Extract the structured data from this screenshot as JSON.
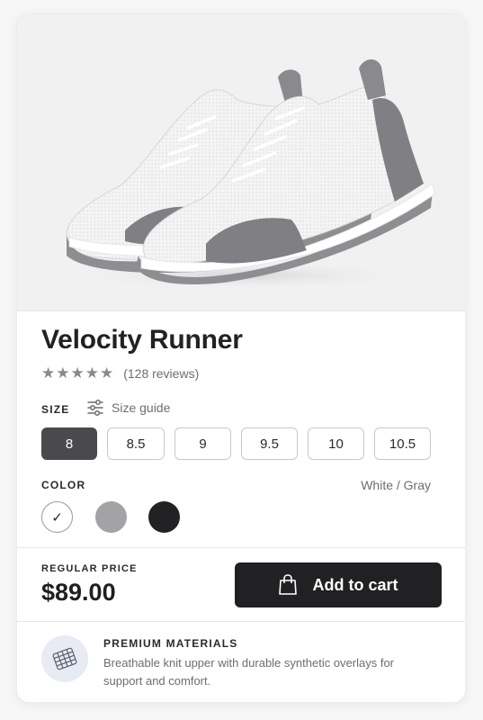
{
  "product": {
    "title": "Velocity Runner",
    "image_alt": "white and gray running shoes",
    "rating_stars": "★★★★★",
    "rating_value": 5,
    "reviews": "(128 reviews)"
  },
  "size": {
    "label": "SIZE",
    "guide_label": "Size guide",
    "options": [
      "8",
      "8.5",
      "9",
      "9.5",
      "10",
      "10.5"
    ],
    "selected": "8"
  },
  "color": {
    "label": "COLOR",
    "selected_name": "White / Gray",
    "swatches": [
      {
        "name": "white",
        "hex": "#ffffff",
        "selected": true
      },
      {
        "name": "gray",
        "hex": "#a3a3a6",
        "selected": false
      },
      {
        "name": "black",
        "hex": "#222224",
        "selected": false
      }
    ],
    "check_glyph": "✓"
  },
  "pricing": {
    "label": "REGULAR PRICE",
    "price": "$89.00",
    "cta_label": "Add to cart"
  },
  "feature": {
    "title": "PREMIUM MATERIALS",
    "description": "Breathable knit upper with durable synthetic overlays for support and comfort."
  },
  "colors": {
    "accent": "#212123",
    "selected_size_bg": "#4a4a4e",
    "icon_bg": "#e8ebf3"
  },
  "icons": {
    "size_guide": "sliders-icon",
    "cart": "shopping-bag-icon",
    "feature": "mesh-fabric-icon",
    "check": "check-icon"
  }
}
